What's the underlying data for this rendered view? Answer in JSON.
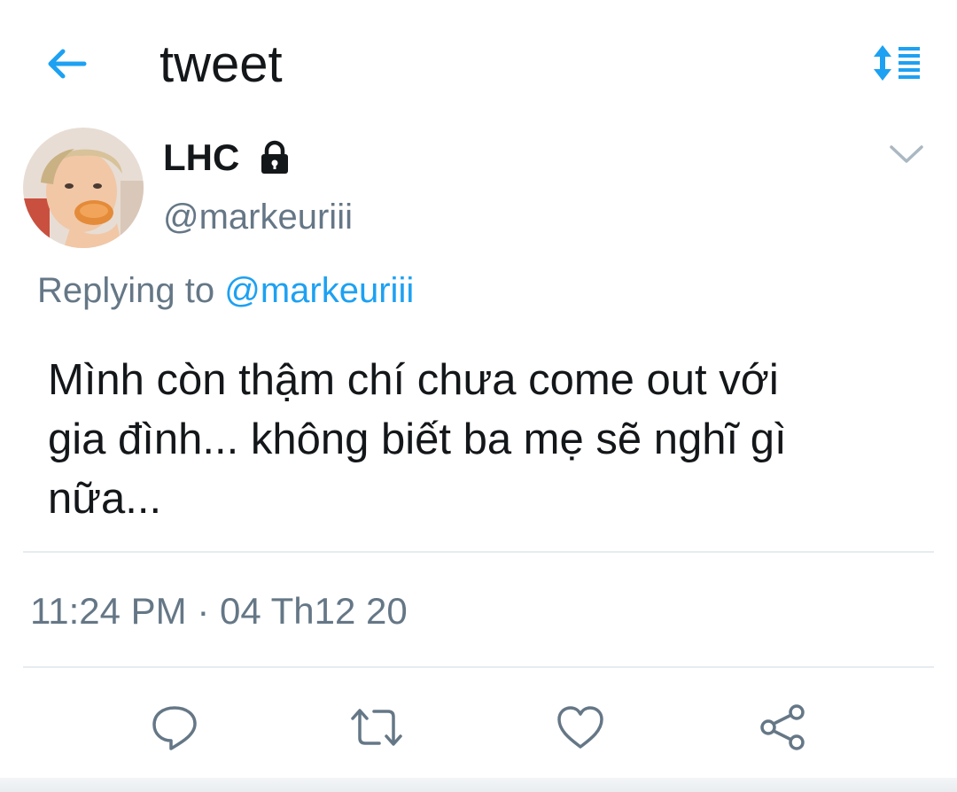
{
  "header": {
    "title": "tweet",
    "back_icon": "arrow-left-icon",
    "sort_icon": "sort-list-icon",
    "accent_color": "#1da1f2"
  },
  "tweet": {
    "author": {
      "display_name": "LHC",
      "handle": "@markeuriii",
      "protected_icon": "lock-icon",
      "avatar": "avatar-photo"
    },
    "reply": {
      "prefix": "Replying to",
      "target": "@markeuriii"
    },
    "text": "Mình còn thậm chí chưa come out với\ngia đình... không biết ba mẹ sẽ nghĩ gì\nnữa...",
    "timestamp": "11:24 PM · 04 Th12 20"
  },
  "actions": [
    {
      "name": "reply-button",
      "icon": "comment-icon"
    },
    {
      "name": "retweet-button",
      "icon": "retweet-icon"
    },
    {
      "name": "like-button",
      "icon": "heart-icon"
    },
    {
      "name": "share-button",
      "icon": "share-icon"
    }
  ],
  "colors": {
    "text": "#14171a",
    "secondary": "#657786",
    "link": "#1da1f2",
    "divider": "#e6ecf0"
  }
}
